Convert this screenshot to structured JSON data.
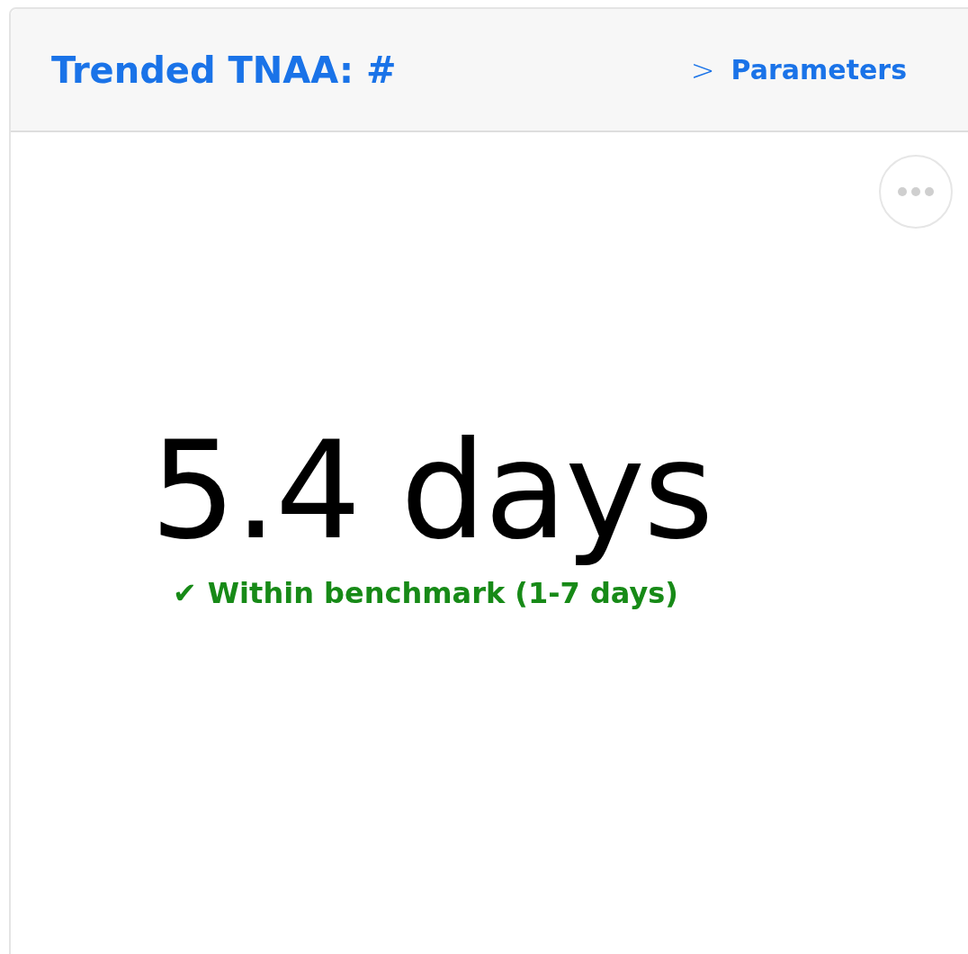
{
  "card": {
    "title": "Trended TNAA: #",
    "parameters_link": {
      "icon": ">",
      "label": "Parameters"
    }
  },
  "metric": {
    "value": "5.4 days"
  },
  "status": {
    "kind": "ok",
    "icon": "✔",
    "text": "Within benchmark (1-7 days)"
  }
}
